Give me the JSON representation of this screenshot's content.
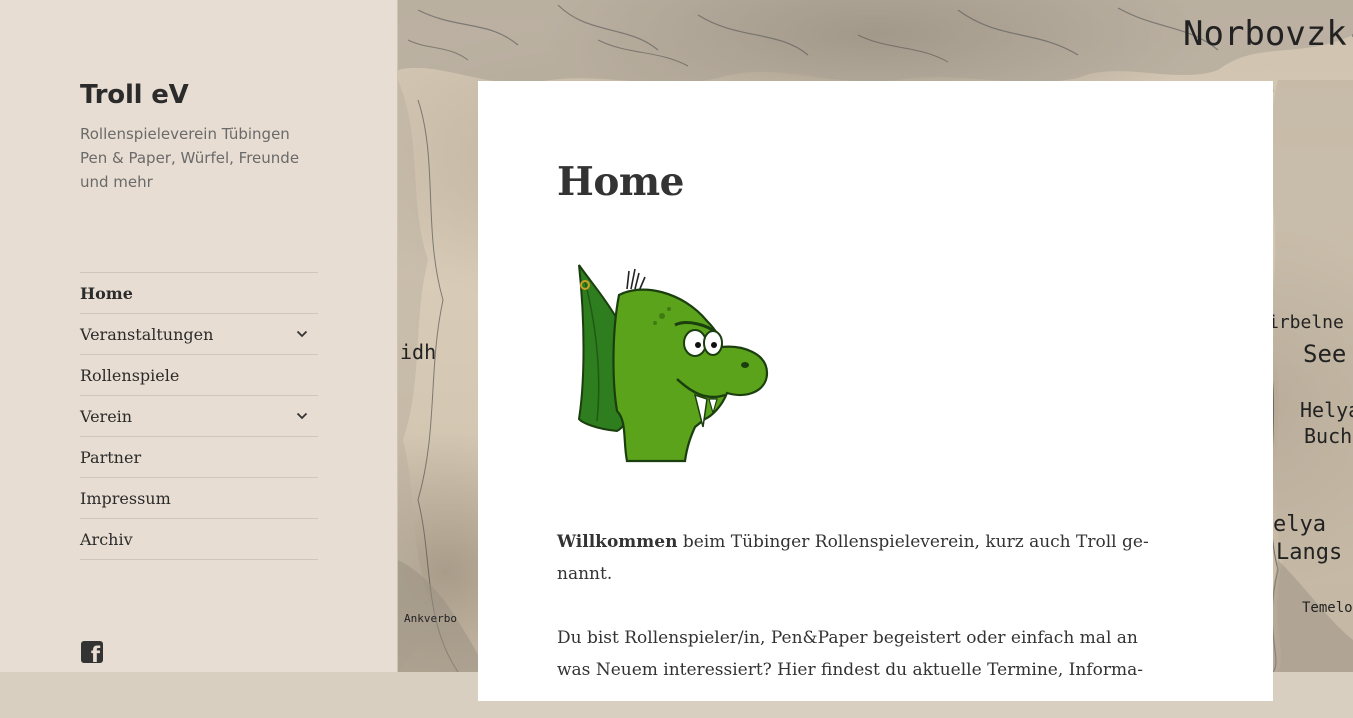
{
  "site": {
    "title": "Troll eV",
    "description_lines": [
      "Rollenspieleverein Tübingen",
      "Pen & Paper, Würfel, Freunde",
      "und mehr"
    ]
  },
  "nav": {
    "items": [
      {
        "label": "Home",
        "active": true,
        "has_submenu": false
      },
      {
        "label": "Veranstaltungen",
        "active": false,
        "has_submenu": true
      },
      {
        "label": "Rollenspiele",
        "active": false,
        "has_submenu": false
      },
      {
        "label": "Verein",
        "active": false,
        "has_submenu": true
      },
      {
        "label": "Partner",
        "active": false,
        "has_submenu": false
      },
      {
        "label": "Impressum",
        "active": false,
        "has_submenu": false
      },
      {
        "label": "Archiv",
        "active": false,
        "has_submenu": false
      }
    ]
  },
  "social": {
    "facebook_icon": "facebook-icon"
  },
  "map": {
    "labels": [
      "Norbovzk-",
      "irbelne",
      "See",
      "Helya",
      "Bucht",
      "idh",
      "elya",
      "Langs",
      "Temelo",
      "Ankverbo"
    ]
  },
  "article": {
    "title": "Home",
    "image_alt": "troll-mascot",
    "para1_strong": "Willkommen",
    "para1_lines": [
      " beim Tübinger Rollenspieleverein, kurz auch Troll ge-",
      "nannt."
    ],
    "para2_lines": [
      "Du bist Rollenspieler/in, Pen&Paper begeistert oder einfach mal an",
      "was Neuem interessiert? Hier findest du aktuelle Termine, Informa-"
    ]
  },
  "colors": {
    "sidebar_bg": "#e8ddd2",
    "text": "#333333",
    "troll_green": "#5aa31b"
  }
}
